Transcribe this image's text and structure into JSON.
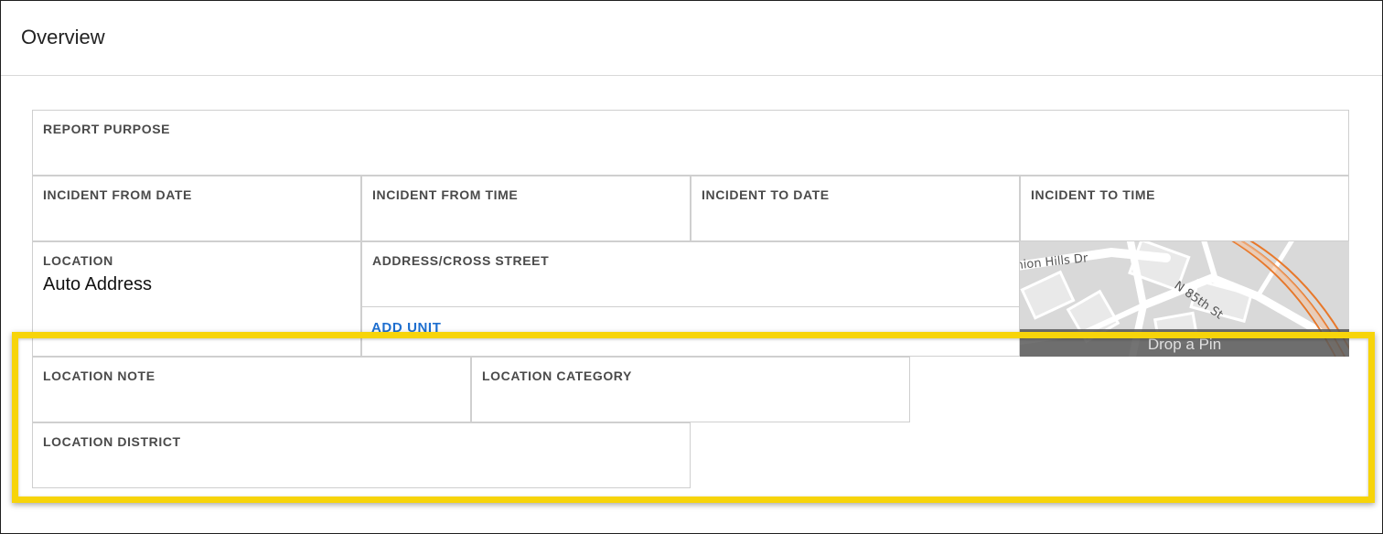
{
  "header": {
    "title": "Overview"
  },
  "fields": {
    "report_purpose": "REPORT PURPOSE",
    "incident_from_date": "INCIDENT FROM DATE",
    "incident_from_time": "INCIDENT FROM TIME",
    "incident_to_date": "INCIDENT TO DATE",
    "incident_to_time": "INCIDENT TO TIME",
    "location": {
      "label": "LOCATION",
      "value": "Auto Address"
    },
    "address_cross_street": "ADDRESS/CROSS STREET",
    "add_unit": "ADD UNIT",
    "location_note": "LOCATION NOTE",
    "location_category": "LOCATION CATEGORY",
    "location_district": "LOCATION DISTRICT"
  },
  "map": {
    "street_1": "nion Hills Dr",
    "street_2": "N 85th St",
    "drop_pin": "Drop a Pin"
  },
  "colors": {
    "highlight": "#f7d40a",
    "link": "#1e6fd0",
    "highway": "#e8782a"
  }
}
